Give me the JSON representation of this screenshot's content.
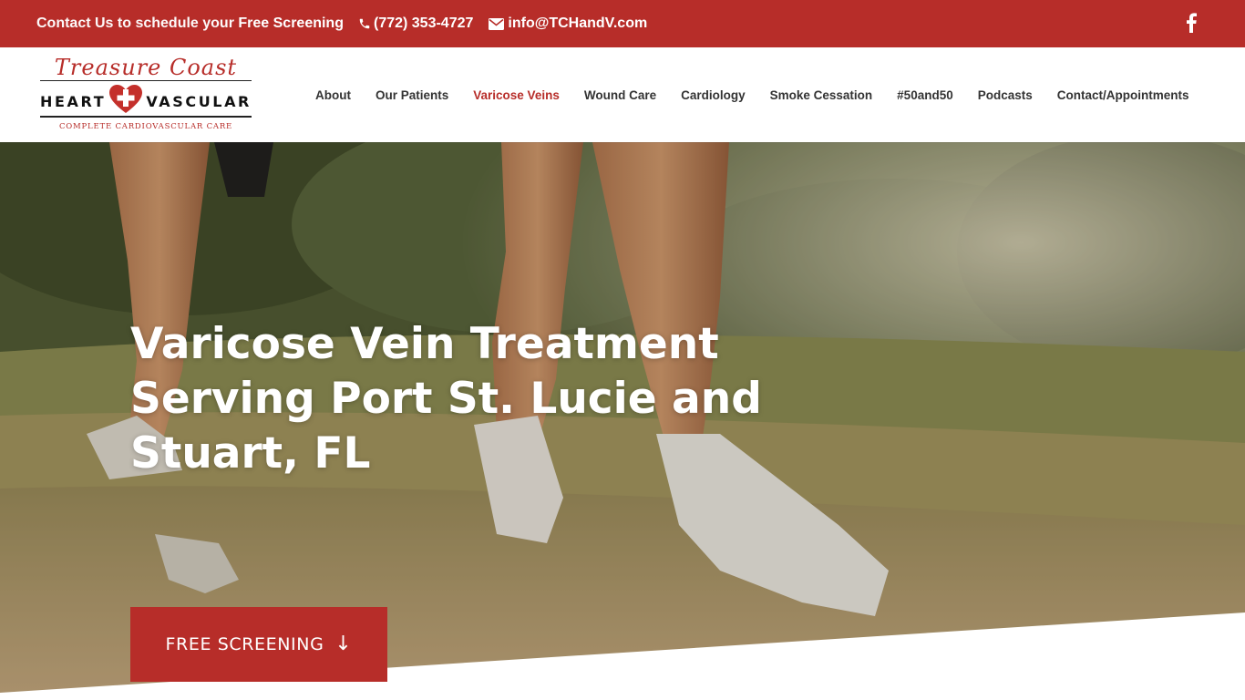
{
  "topbar": {
    "promo_lead": "Contact Us to schedule your",
    "promo_strong": "Free Screening",
    "phone": "(772) 353-4727",
    "email": "info@TCHandV.com",
    "social_icon": "facebook-icon",
    "background_color": "#b72d29"
  },
  "logo": {
    "script": "Treasure Coast",
    "word_left": "HEART",
    "word_right": "VASCULAR",
    "tagline": "COMPLETE CARDIOVASCULAR CARE",
    "icon": "heart-cross-icon"
  },
  "nav": {
    "items": [
      {
        "label": "About"
      },
      {
        "label": "Our Patients"
      },
      {
        "label": "Varicose Veins",
        "active": true
      },
      {
        "label": "Wound Care"
      },
      {
        "label": "Cardiology"
      },
      {
        "label": "Smoke Cessation"
      },
      {
        "label": "#50and50"
      },
      {
        "label": "Podcasts"
      },
      {
        "label": "Contact/Appointments"
      }
    ],
    "active_color": "#b72d29"
  },
  "hero": {
    "title_line1": "Varicose Vein Treatment",
    "title_line2": "Serving Port St. Lucie and",
    "title_line3": "Stuart, FL",
    "cta_label": "FREE SCREENING",
    "cta_icon": "arrow-down-icon",
    "background": "runners-legs-on-trail-photo"
  },
  "colors": {
    "brand_red": "#b72d29",
    "nav_text": "#333333"
  }
}
